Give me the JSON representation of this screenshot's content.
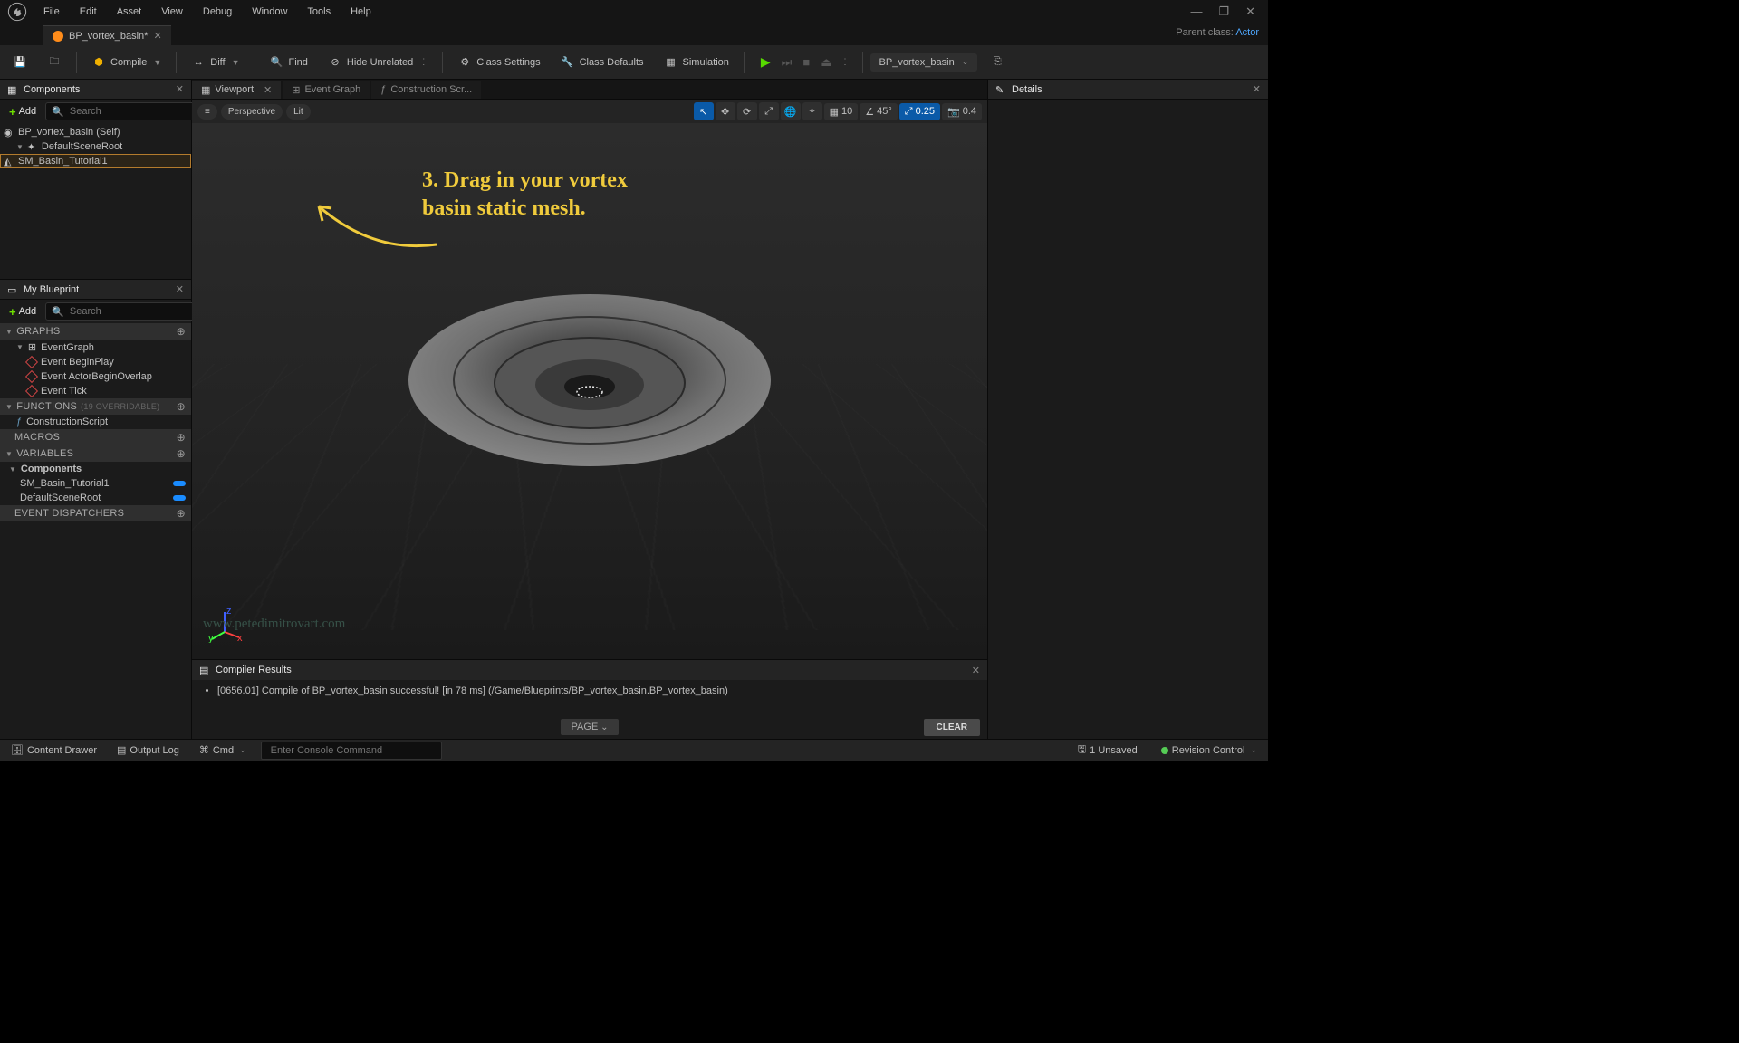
{
  "menubar": {
    "items": [
      "File",
      "Edit",
      "Asset",
      "View",
      "Debug",
      "Window",
      "Tools",
      "Help"
    ]
  },
  "asset_tab": {
    "label": "BP_vortex_basin*"
  },
  "parent_class": {
    "prefix": "Parent class:",
    "link": "Actor"
  },
  "toolbar": {
    "compile": "Compile",
    "diff": "Diff",
    "find": "Find",
    "hide_unrelated": "Hide Unrelated",
    "class_settings": "Class Settings",
    "class_defaults": "Class Defaults",
    "simulation": "Simulation",
    "breadcrumb": "BP_vortex_basin"
  },
  "components": {
    "title": "Components",
    "add": "Add",
    "search_placeholder": "Search",
    "tree": {
      "root": "BP_vortex_basin (Self)",
      "scene_root": "DefaultSceneRoot",
      "mesh": "SM_Basin_Tutorial1"
    }
  },
  "my_blueprint": {
    "title": "My Blueprint",
    "add": "Add",
    "search_placeholder": "Search",
    "sections": {
      "graphs": "GRAPHS",
      "event_graph": "EventGraph",
      "events": [
        "Event BeginPlay",
        "Event ActorBeginOverlap",
        "Event Tick"
      ],
      "functions": "FUNCTIONS",
      "functions_hint": "(19 OVERRIDABLE)",
      "construction": "ConstructionScript",
      "macros": "MACROS",
      "variables": "VARIABLES",
      "components_sub": "Components",
      "vars": [
        "SM_Basin_Tutorial1",
        "DefaultSceneRoot"
      ],
      "event_dispatchers": "EVENT DISPATCHERS"
    }
  },
  "center": {
    "tabs": {
      "viewport": "Viewport",
      "event_graph": "Event Graph",
      "construction": "Construction Scr..."
    },
    "view_mode": "Perspective",
    "lit": "Lit",
    "grid_snap": "10",
    "angle_snap": "45°",
    "scale_snap": "0.25",
    "cam_speed": "0.4"
  },
  "annotation": {
    "text": "3. Drag in your vortex basin static mesh."
  },
  "compiler": {
    "title": "Compiler Results",
    "line": "[0656.01] Compile of BP_vortex_basin successful! [in 78 ms] (/Game/Blueprints/BP_vortex_basin.BP_vortex_basin)",
    "page": "PAGE",
    "clear": "CLEAR"
  },
  "details": {
    "title": "Details"
  },
  "statusbar": {
    "content_drawer": "Content Drawer",
    "output_log": "Output Log",
    "cmd": "Cmd",
    "cmd_placeholder": "Enter Console Command",
    "unsaved": "1 Unsaved",
    "revision": "Revision Control"
  },
  "watermark": "www.petedimitrovart.com"
}
